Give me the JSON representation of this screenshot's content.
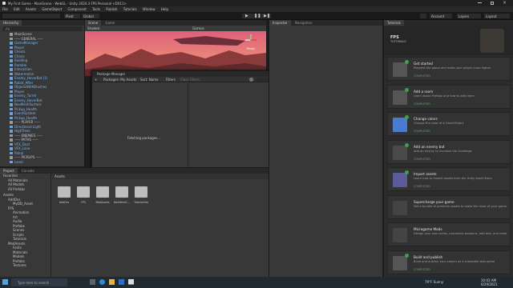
{
  "window": {
    "title": "My First Game - MainScene - WebGL - Unity 2020.3 FPS Personal <DX11>",
    "min_icon": "minimize-icon",
    "max_icon": "maximize-icon",
    "close_icon": "close-icon"
  },
  "menu": [
    "File",
    "Edit",
    "Assets",
    "GameObject",
    "Component",
    "Tools",
    "Publish",
    "Tutorials",
    "Window",
    "Help"
  ],
  "toolbar": {
    "pivot": "Pivot",
    "global": "Global",
    "account": "Account",
    "layers": "Layers",
    "layout": "Layout"
  },
  "hierarchy": {
    "tab": "Hierarchy",
    "search_placeholder": "All",
    "items": [
      {
        "label": "MainScene",
        "dim": true
      },
      {
        "label": "----- GENERAL -----",
        "dim": true
      },
      {
        "label": "GameManager"
      },
      {
        "label": "Player"
      },
      {
        "label": "Chests"
      },
      {
        "label": "Chairs"
      },
      {
        "label": "Building"
      },
      {
        "label": "Ramble"
      },
      {
        "label": "Interaction"
      },
      {
        "label": "Watermelon"
      },
      {
        "label": "Enemy_HoverBot (1)"
      },
      {
        "label": "Robot_After"
      },
      {
        "label": "ObjectsWithBrushes"
      },
      {
        "label": "Player"
      },
      {
        "label": "Enemy_Turret"
      },
      {
        "label": "Enemy_HoverBot"
      },
      {
        "label": "NavMeshSurface"
      },
      {
        "label": "Pickup_Health"
      },
      {
        "label": "EventSystem"
      },
      {
        "label": "Pickup_Health"
      },
      {
        "label": "----- PLAYER -----",
        "dim": true
      },
      {
        "label": "Directional Light"
      },
      {
        "label": "HighTrees"
      },
      {
        "label": "----- ENEMIES -----",
        "dim": true
      },
      {
        "label": "----- PATHS -----",
        "dim": true
      },
      {
        "label": "VFX_Dust"
      },
      {
        "label": "VFX_Lava"
      },
      {
        "label": "Patrol"
      },
      {
        "label": "----- PICKUPS -----",
        "dim": true
      },
      {
        "label": "Level"
      }
    ]
  },
  "scene": {
    "tab_scene": "Scene",
    "tab_game": "Game",
    "shading": "Shaded",
    "gizmos": "Gizmos",
    "persp": "Persp"
  },
  "package_manager": {
    "title": "Package Manager",
    "scope": "Packages: My Assets",
    "sort": "Sort: Name",
    "filters": "Filters",
    "clear_filters": "Clear Filters",
    "status": "Fetching packages...",
    "footer": "Refreshing packages..."
  },
  "inspector": {
    "tab_inspector": "Inspector",
    "tab_navigation": "Navigation"
  },
  "tutorials": {
    "tab": "Tutorials",
    "header_label": "FPS",
    "header_sub": "TUTORIALS",
    "cards": [
      {
        "title": "Get started",
        "desc": "Playtest the game and make your player jump higher",
        "status": "COMPLETED",
        "icon": "gamepad-icon"
      },
      {
        "title": "Add a room",
        "desc": "Learn about Prefabs and how to add them",
        "status": "COMPLETED",
        "icon": "room-icon"
      },
      {
        "title": "Change colors",
        "desc": "Change the color of a GameObject",
        "status": "COMPLETED",
        "icon": "palette-icon"
      },
      {
        "title": "Add an enemy bot",
        "desc": "Add an enemy to increase the challenge",
        "status": "COMPLETED",
        "icon": "enemy-icon"
      },
      {
        "title": "Import assets",
        "desc": "Learn how to import assets from the Unity Asset Store",
        "status": "COMPLETED",
        "icon": "import-icon"
      },
      {
        "title": "Supercharge your game",
        "desc": "Get a bundle of premium assets to make the most of your game",
        "status": "",
        "icon": "external-link-icon"
      },
      {
        "title": "Microgame Mods",
        "desc": "Design your own levels, customize weapons, add text, and more",
        "status": "",
        "icon": "external-link-icon"
      },
      {
        "title": "Build and publish",
        "desc": "Build and publish your project as a shareable web game",
        "status": "COMPLETED",
        "icon": "publish-icon"
      }
    ]
  },
  "project": {
    "tab_project": "Project",
    "tab_console": "Console",
    "favorites": [
      "Favorites",
      "All Materials",
      "All Models",
      "All Prefabs"
    ],
    "tree": [
      "Assets",
      "AddOns",
      "MyDD_Asset",
      "FPS",
      "Animation",
      "Art",
      "Audio",
      "Prefabs",
      "Scenes",
      "Scripts",
      "Tutorials",
      "ModAssets",
      "Fonts",
      "Materials",
      "Models",
      "Prefabs",
      "Textures"
    ],
    "breadcrumb": "Assets",
    "asset_labels": [
      "AddOns",
      "FPS",
      "ModAssets",
      "NavMeshC...",
      "TutorialInfo"
    ]
  },
  "taskbar": {
    "search": "Type here to search",
    "weather": "79°F  Sunny",
    "time": "10:03 AM",
    "date": "6/29/2021"
  }
}
